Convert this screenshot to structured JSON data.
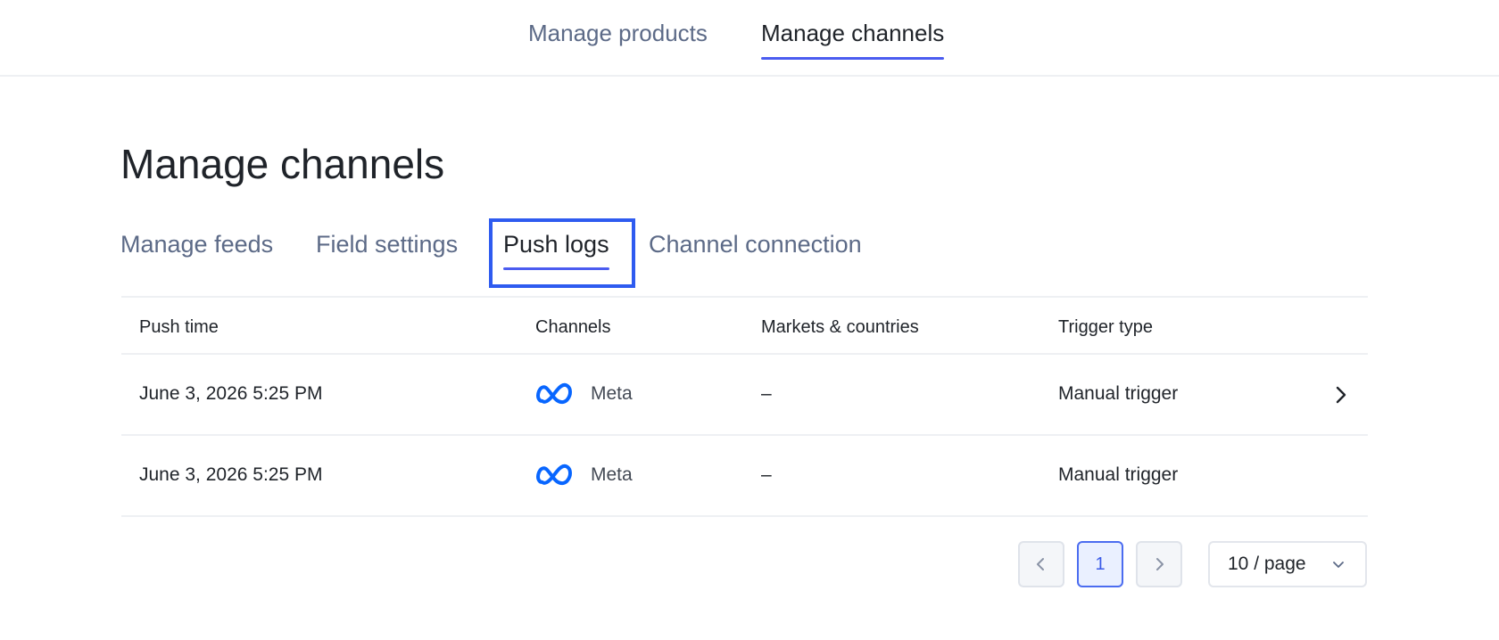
{
  "top_nav": {
    "tabs": [
      {
        "label": "Manage products",
        "active": false
      },
      {
        "label": "Manage channels",
        "active": true
      }
    ]
  },
  "page": {
    "title": "Manage channels"
  },
  "sub_tabs": [
    {
      "label": "Manage feeds",
      "active": false
    },
    {
      "label": "Field settings",
      "active": false
    },
    {
      "label": "Push logs",
      "active": true
    },
    {
      "label": "Channel connection",
      "active": false
    }
  ],
  "table": {
    "columns": [
      "Push time",
      "Channels",
      "Markets & countries",
      "Trigger type"
    ],
    "rows": [
      {
        "push_time": "June 3, 2026 5:25 PM",
        "channel": "Meta",
        "channel_icon": "meta-logo-icon",
        "markets": "–",
        "trigger": "Manual trigger",
        "has_chevron": true
      },
      {
        "push_time": "June 3, 2026 5:25 PM",
        "channel": "Meta",
        "channel_icon": "meta-logo-icon",
        "markets": "–",
        "trigger": "Manual trigger",
        "has_chevron": false
      }
    ]
  },
  "pagination": {
    "prev_icon": "chevron-left-icon",
    "current_page": "1",
    "next_icon": "chevron-right-icon",
    "page_size": "10 / page",
    "page_size_icon": "chevron-down-icon"
  },
  "colors": {
    "accent": "#4b5cf0",
    "focus_outline": "#2e5bf0",
    "meta_blue": "#0866ff",
    "muted_text": "#5c6a87"
  }
}
